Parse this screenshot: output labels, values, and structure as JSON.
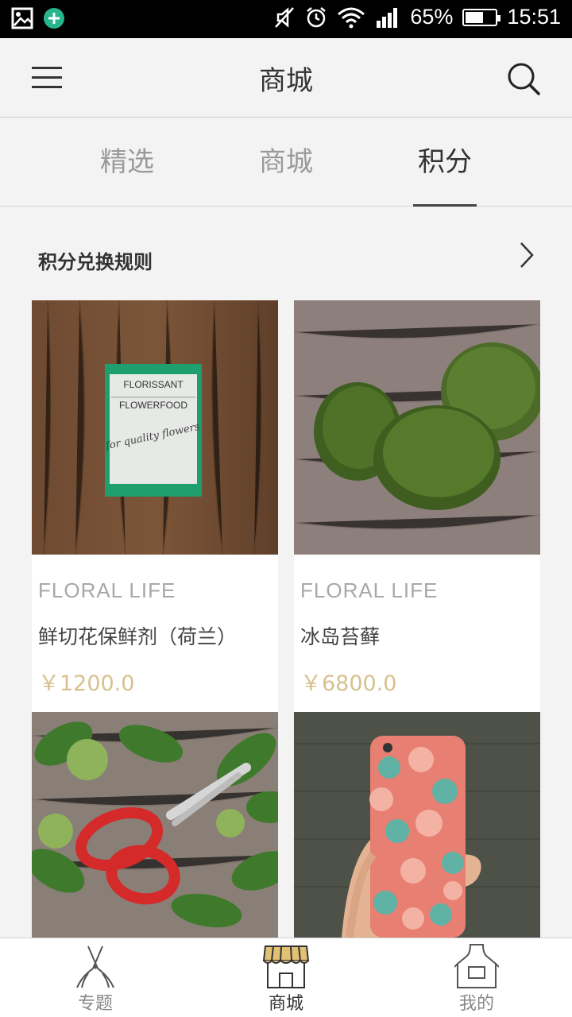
{
  "status_bar": {
    "battery": "65%",
    "battery_level": 0.65,
    "time": "15:51",
    "icons": [
      "image-icon",
      "add-circle-icon",
      "mute-icon",
      "alarm-icon",
      "wifi-icon",
      "signal-icon",
      "battery-icon"
    ]
  },
  "header": {
    "title": "商城",
    "menu_icon": "hamburger-menu-icon",
    "search_icon": "search-icon"
  },
  "tabs": [
    {
      "label": "精选",
      "active": false
    },
    {
      "label": "商城",
      "active": false
    },
    {
      "label": "积分",
      "active": true
    }
  ],
  "rules": {
    "label": "积分兑换规则",
    "icon": "chevron-right-icon"
  },
  "products": [
    {
      "brand": "FLORAL LIFE",
      "name": "鲜切花保鲜剂（荷兰）",
      "price": "￥1200.0",
      "image_text": [
        "FLORISSANT",
        "FLOWERFOOD",
        "for quality flowers"
      ]
    },
    {
      "brand": "FLORAL LIFE",
      "name": "冰岛苔藓",
      "price": "￥6800.0"
    },
    {
      "brand": "",
      "name": "",
      "price": ""
    },
    {
      "brand": "",
      "name": "",
      "price": ""
    }
  ],
  "bottom_nav": [
    {
      "label": "专题",
      "icon": "pruning-shears-icon",
      "active": false
    },
    {
      "label": "商城",
      "icon": "storefront-icon",
      "active": true
    },
    {
      "label": "我的",
      "icon": "apron-icon",
      "active": false
    }
  ],
  "colors": {
    "accent_gold": "#d8c18f",
    "store_awning": "#e2c074",
    "packet_green": "#1f9e6e"
  }
}
